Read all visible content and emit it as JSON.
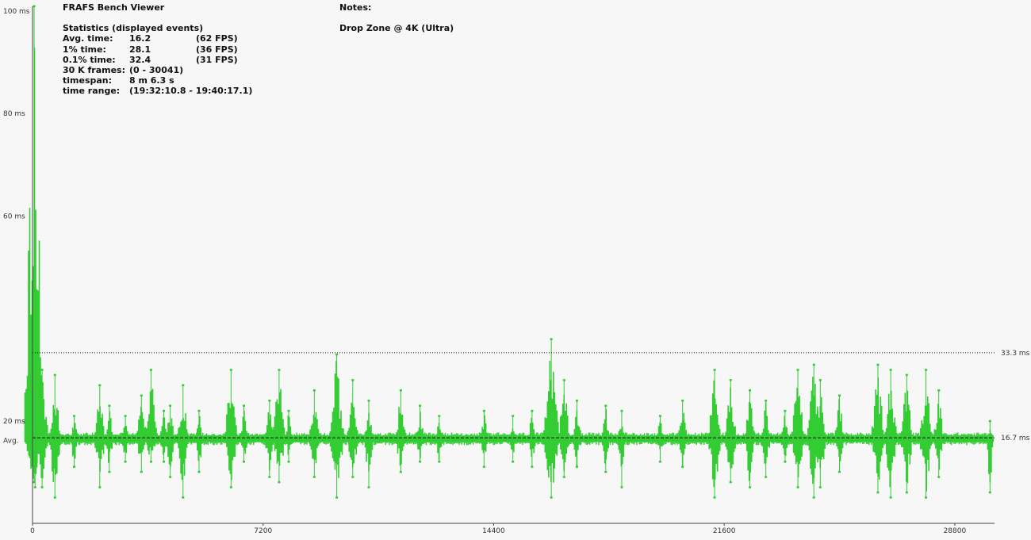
{
  "app": {
    "title": "FRAFS Bench Viewer"
  },
  "stats": {
    "heading": "Statistics (displayed events)",
    "rows": [
      {
        "label": "Avg. time:",
        "value": "16.2",
        "extra": "(62 FPS)"
      },
      {
        "label": "1% time:",
        "value": "28.1",
        "extra": "(36 FPS)"
      },
      {
        "label": "0.1% time:",
        "value": "32.4",
        "extra": "(31 FPS)"
      },
      {
        "label": "30 K frames:",
        "value": "(0 - 30041)",
        "extra": ""
      },
      {
        "label": "timespan:",
        "value": "8 m 6.3 s",
        "extra": ""
      },
      {
        "label": "time range:",
        "value": "(19:32:10.8 - 19:40:17.1)",
        "extra": ""
      }
    ]
  },
  "notes": {
    "label": "Notes:",
    "text": "Drop Zone @ 4K (Ultra)"
  },
  "colors": {
    "series": "#33cc33",
    "background": "#f7f7f7",
    "reference_line": "#111111"
  },
  "chart_data": {
    "type": "scatter",
    "title": "",
    "xlabel": "",
    "ylabel": "",
    "xlim": [
      0,
      30041
    ],
    "ylim": [
      0,
      100
    ],
    "x_ticks": [
      {
        "value": 0,
        "label": "0"
      },
      {
        "value": 7200,
        "label": "7200"
      },
      {
        "value": 14400,
        "label": "14400"
      },
      {
        "value": 21600,
        "label": "21600"
      },
      {
        "value": 28800,
        "label": "28800"
      }
    ],
    "y_ticks": [
      {
        "value": 100,
        "label": "100 ms"
      },
      {
        "value": 80,
        "label": "80 ms"
      },
      {
        "value": 60,
        "label": "60 ms"
      },
      {
        "value": 20,
        "label": "20 ms"
      },
      {
        "value": 16.2,
        "label": "Avg."
      }
    ],
    "reference_lines": [
      {
        "value": 33.3,
        "label": "33.3 ms",
        "style": "dotted"
      },
      {
        "value": 16.7,
        "label": "16.7 ms",
        "style": "dashed"
      }
    ],
    "series": [
      {
        "baseline_ms": 16.5,
        "spikes": [
          {
            "frame": 50,
            "max_ms": 101,
            "min_ms": 8
          },
          {
            "frame": 80,
            "max_ms": 40,
            "min_ms": 7
          },
          {
            "frame": 300,
            "max_ms": 30,
            "min_ms": 7
          },
          {
            "frame": 700,
            "max_ms": 29,
            "min_ms": 5
          },
          {
            "frame": 1300,
            "max_ms": 21,
            "min_ms": 11
          },
          {
            "frame": 2100,
            "max_ms": 27,
            "min_ms": 7
          },
          {
            "frame": 2400,
            "max_ms": 23,
            "min_ms": 10
          },
          {
            "frame": 2900,
            "max_ms": 21,
            "min_ms": 12
          },
          {
            "frame": 3400,
            "max_ms": 25,
            "min_ms": 10
          },
          {
            "frame": 3700,
            "max_ms": 30,
            "min_ms": 12
          },
          {
            "frame": 4100,
            "max_ms": 22,
            "min_ms": 12
          },
          {
            "frame": 4300,
            "max_ms": 23,
            "min_ms": 9
          },
          {
            "frame": 4700,
            "max_ms": 27,
            "min_ms": 5
          },
          {
            "frame": 5200,
            "max_ms": 22,
            "min_ms": 10
          },
          {
            "frame": 6200,
            "max_ms": 30,
            "min_ms": 7
          },
          {
            "frame": 6600,
            "max_ms": 23,
            "min_ms": 12
          },
          {
            "frame": 7400,
            "max_ms": 24,
            "min_ms": 9
          },
          {
            "frame": 7700,
            "max_ms": 30,
            "min_ms": 8
          },
          {
            "frame": 8000,
            "max_ms": 22,
            "min_ms": 12
          },
          {
            "frame": 8800,
            "max_ms": 26,
            "min_ms": 9
          },
          {
            "frame": 9500,
            "max_ms": 33,
            "min_ms": 5
          },
          {
            "frame": 10000,
            "max_ms": 28,
            "min_ms": 9
          },
          {
            "frame": 10500,
            "max_ms": 24,
            "min_ms": 7
          },
          {
            "frame": 11500,
            "max_ms": 26,
            "min_ms": 10
          },
          {
            "frame": 12100,
            "max_ms": 23,
            "min_ms": 12
          },
          {
            "frame": 12700,
            "max_ms": 21,
            "min_ms": 12
          },
          {
            "frame": 14100,
            "max_ms": 22,
            "min_ms": 11
          },
          {
            "frame": 15000,
            "max_ms": 21,
            "min_ms": 12
          },
          {
            "frame": 15600,
            "max_ms": 22,
            "min_ms": 11
          },
          {
            "frame": 16200,
            "max_ms": 36,
            "min_ms": 5
          },
          {
            "frame": 16600,
            "max_ms": 28,
            "min_ms": 9
          },
          {
            "frame": 17000,
            "max_ms": 24,
            "min_ms": 11
          },
          {
            "frame": 17900,
            "max_ms": 23,
            "min_ms": 10
          },
          {
            "frame": 18400,
            "max_ms": 22,
            "min_ms": 7
          },
          {
            "frame": 19600,
            "max_ms": 21,
            "min_ms": 12
          },
          {
            "frame": 20300,
            "max_ms": 24,
            "min_ms": 11
          },
          {
            "frame": 21300,
            "max_ms": 30,
            "min_ms": 5
          },
          {
            "frame": 21800,
            "max_ms": 28,
            "min_ms": 8
          },
          {
            "frame": 22400,
            "max_ms": 26,
            "min_ms": 7
          },
          {
            "frame": 22900,
            "max_ms": 24,
            "min_ms": 9
          },
          {
            "frame": 23500,
            "max_ms": 22,
            "min_ms": 12
          },
          {
            "frame": 23900,
            "max_ms": 30,
            "min_ms": 7
          },
          {
            "frame": 24400,
            "max_ms": 31,
            "min_ms": 5
          },
          {
            "frame": 24600,
            "max_ms": 28,
            "min_ms": 7
          },
          {
            "frame": 25200,
            "max_ms": 25,
            "min_ms": 10
          },
          {
            "frame": 26400,
            "max_ms": 31,
            "min_ms": 6
          },
          {
            "frame": 26800,
            "max_ms": 30,
            "min_ms": 5
          },
          {
            "frame": 27300,
            "max_ms": 29,
            "min_ms": 6
          },
          {
            "frame": 27900,
            "max_ms": 30,
            "min_ms": 5
          },
          {
            "frame": 28300,
            "max_ms": 26,
            "min_ms": 9
          },
          {
            "frame": 29900,
            "max_ms": 20,
            "min_ms": 6
          }
        ]
      }
    ]
  }
}
